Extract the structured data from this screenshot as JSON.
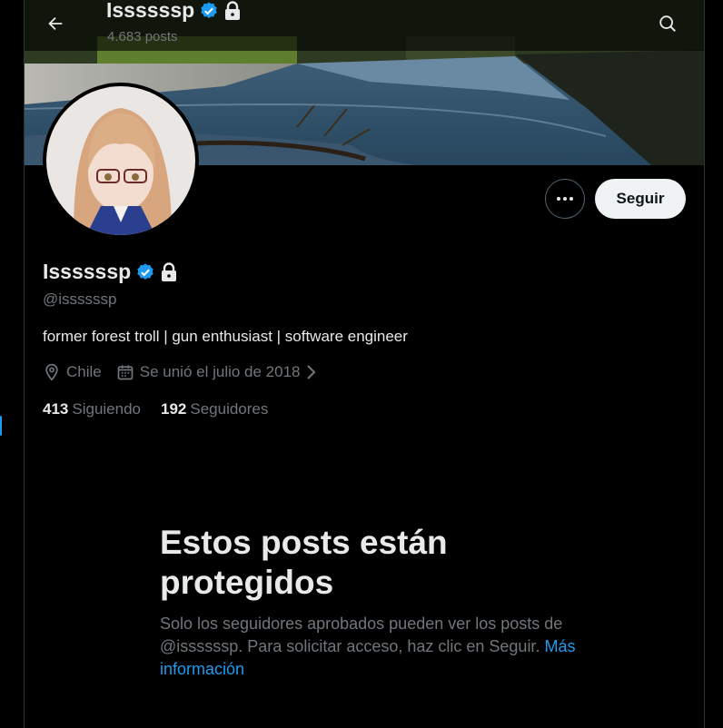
{
  "header": {
    "name": "Issssssp",
    "posts_count": "4.683 posts"
  },
  "profile": {
    "display_name": "Issssssp",
    "handle": "@issssssp",
    "bio": "former forest troll | gun enthusiast | software engineer",
    "location": "Chile",
    "joined": "Se unió el julio de 2018",
    "following_count": "413",
    "following_label": "Siguiendo",
    "followers_count": "192",
    "followers_label": "Seguidores"
  },
  "actions": {
    "follow_label": "Seguir"
  },
  "protected": {
    "title": "Estos posts están protegidos",
    "body": "Solo los seguidores aprobados pueden ver los posts de @issssssp. Para solicitar acceso, haz clic en Seguir.",
    "link": "Más información"
  },
  "icons": {
    "back": "arrow-left-icon",
    "search": "search-icon",
    "verified": "verified-badge-icon",
    "lock": "lock-icon",
    "more": "more-icon",
    "location": "location-pin-icon",
    "calendar": "calendar-icon",
    "chevron": "chevron-right-icon"
  },
  "colors": {
    "background": "#000000",
    "accent": "#1d9bf0",
    "text_primary": "#e7e9ea",
    "text_secondary": "#71767b",
    "follow_button_bg": "#eff3f4"
  }
}
